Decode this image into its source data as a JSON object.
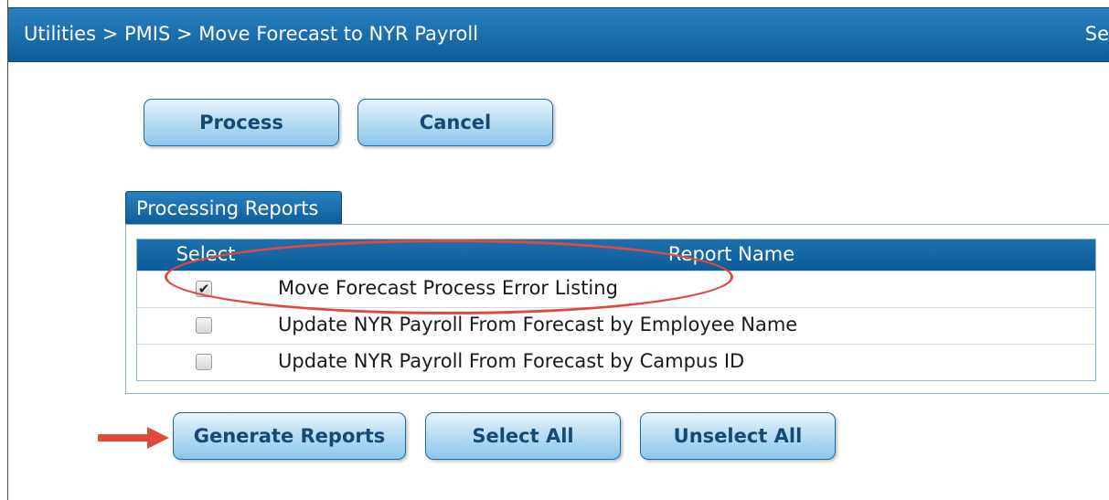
{
  "header": {
    "breadcrumb": "Utilities > PMIS > Move Forecast to NYR Payroll",
    "right_text": "Se"
  },
  "actions": {
    "process_label": "Process",
    "cancel_label": "Cancel"
  },
  "reports": {
    "tab_label": "Processing Reports",
    "columns": {
      "select": "Select",
      "name": "Report Name"
    },
    "rows": [
      {
        "name": "Move Forecast Process Error Listing",
        "checked": true
      },
      {
        "name": "Update NYR Payroll From Forecast by Employee Name",
        "checked": false
      },
      {
        "name": "Update NYR Payroll From Forecast by Campus ID",
        "checked": false
      }
    ]
  },
  "bottom_actions": {
    "generate_label": "Generate Reports",
    "select_all_label": "Select All",
    "unselect_all_label": "Unselect All"
  },
  "colors": {
    "header_blue": "#1467a8",
    "annotation_red": "#e04a3c",
    "button_text": "#144a74"
  },
  "icons": {
    "checkmark": "check-icon",
    "arrow": "arrow-right-icon"
  }
}
